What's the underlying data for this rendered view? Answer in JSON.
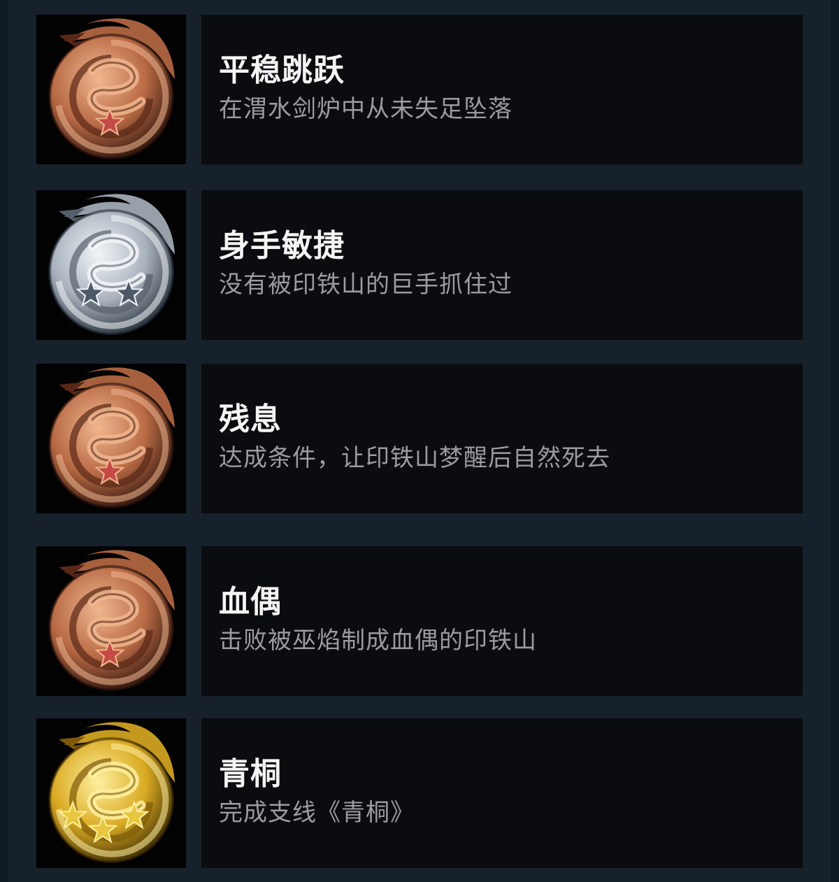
{
  "achievements": [
    {
      "title": "平稳跳跃",
      "description": "在渭水剑炉中从未失足坠落",
      "tier": "bronze",
      "stars": 1,
      "icon": "bronze-dragon-medal-icon"
    },
    {
      "title": "身手敏捷",
      "description": "没有被印铁山的巨手抓住过",
      "tier": "silver",
      "stars": 2,
      "icon": "silver-dragon-medal-icon"
    },
    {
      "title": "残息",
      "description": "达成条件，让印铁山梦醒后自然死去",
      "tier": "bronze",
      "stars": 1,
      "icon": "bronze-dragon-medal-icon"
    },
    {
      "title": "血偶",
      "description": "击败被巫焰制成血偶的印铁山",
      "tier": "bronze",
      "stars": 1,
      "icon": "bronze-dragon-medal-icon"
    },
    {
      "title": "青桐",
      "description": "完成支线《青桐》",
      "tier": "gold",
      "stars": 3,
      "icon": "gold-dragon-medal-icon"
    }
  ],
  "colors": {
    "background": "#17212c",
    "card": "#0a0c10",
    "title": "#f4f4f4",
    "description": "#9a9ca0",
    "bronze": "#b86a44",
    "silver": "#a9b2bd",
    "gold": "#d9aa22"
  }
}
